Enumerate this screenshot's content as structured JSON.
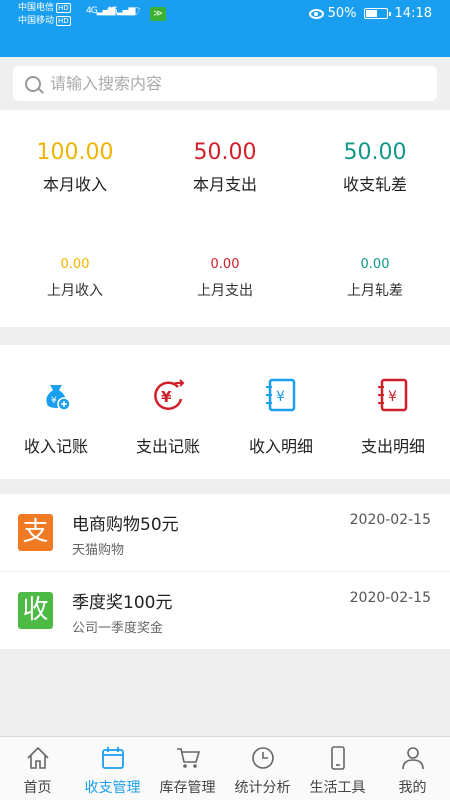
{
  "status_bar": {
    "carrier1": "中国电信",
    "carrier2": "中国移动",
    "hd": "HD",
    "network1": "4G",
    "network2": "4G",
    "battery": "50%",
    "time": "14:18"
  },
  "search": {
    "placeholder": "请输入搜索内容"
  },
  "stats": {
    "month_income": {
      "value": "100.00",
      "label": "本月收入",
      "color": "#f0b400"
    },
    "month_expense": {
      "value": "50.00",
      "label": "本月支出",
      "color": "#d0202a"
    },
    "month_balance": {
      "value": "50.00",
      "label": "收支轧差",
      "color": "#12988a"
    },
    "last_income": {
      "value": "0.00",
      "label": "上月收入",
      "color": "#f0b400"
    },
    "last_expense": {
      "value": "0.00",
      "label": "上月支出",
      "color": "#d0202a"
    },
    "last_balance": {
      "value": "0.00",
      "label": "上月轧差",
      "color": "#12988a"
    }
  },
  "actions": [
    {
      "label": "收入记账",
      "icon": "money-bag-add-icon"
    },
    {
      "label": "支出记账",
      "icon": "yen-out-icon"
    },
    {
      "label": "收入明细",
      "icon": "income-list-icon"
    },
    {
      "label": "支出明细",
      "icon": "expense-list-icon"
    }
  ],
  "records": [
    {
      "badge": "支",
      "badge_color": "#f07a23",
      "title": "电商购物50元",
      "subtitle": "天猫购物",
      "date": "2020-02-15"
    },
    {
      "badge": "收",
      "badge_color": "#4cba45",
      "title": "季度奖100元",
      "subtitle": "公司一季度奖金",
      "date": "2020-02-15"
    }
  ],
  "nav": [
    {
      "label": "首页",
      "icon": "home-icon"
    },
    {
      "label": "收支管理",
      "icon": "calendar-icon",
      "active": true
    },
    {
      "label": "库存管理",
      "icon": "cart-icon"
    },
    {
      "label": "统计分析",
      "icon": "clock-icon"
    },
    {
      "label": "生活工具",
      "icon": "phone-icon"
    },
    {
      "label": "我的",
      "icon": "user-icon"
    }
  ],
  "colors": {
    "primary": "#1a9ff0"
  }
}
